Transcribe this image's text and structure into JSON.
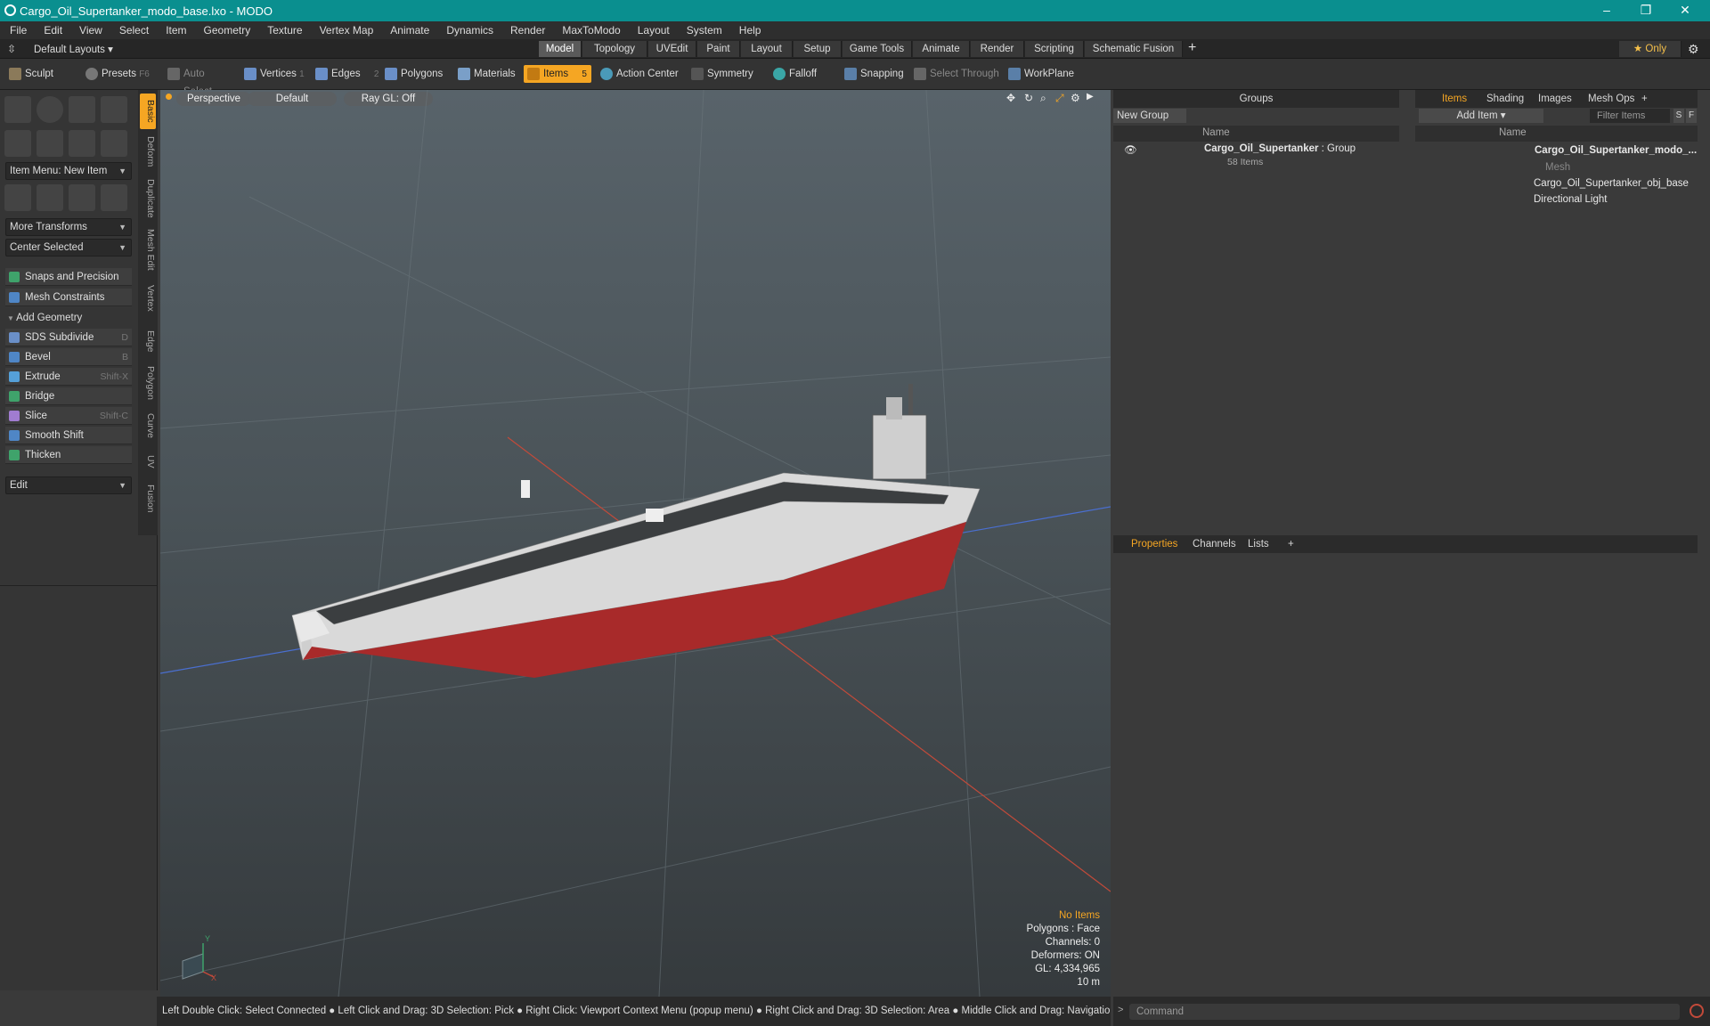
{
  "window": {
    "title": "Cargo_Oil_Supertanker_modo_base.lxo - MODO",
    "minimize": "–",
    "maximize": "❐",
    "close": "✕"
  },
  "menu": [
    "File",
    "Edit",
    "View",
    "Select",
    "Item",
    "Geometry",
    "Texture",
    "Vertex Map",
    "Animate",
    "Dynamics",
    "Render",
    "MaxToModo",
    "Layout",
    "System",
    "Help"
  ],
  "layoutbar": {
    "layouts_label": "Default Layouts ▾",
    "tabs": [
      "Model",
      "Topology",
      "UVEdit",
      "Paint",
      "Layout",
      "Setup",
      "Game Tools",
      "Animate",
      "Render",
      "Scripting",
      "Schematic Fusion"
    ],
    "active_tab": "Model",
    "add_tab": "+",
    "only_label": "★ Only"
  },
  "toolbar": {
    "sculpt": "Sculpt",
    "presets": "Presets",
    "presets_key": "F6",
    "auto_select": "Auto Select",
    "vertices": "Vertices",
    "vertices_count": "1",
    "edges": "Edges",
    "edges_count": "2",
    "polygons": "Polygons",
    "materials": "Materials",
    "items": "Items",
    "items_count": "5",
    "action_center": "Action Center",
    "symmetry": "Symmetry",
    "falloff": "Falloff",
    "snapping": "Snapping",
    "select_through": "Select Through",
    "workplane": "WorkPlane"
  },
  "left": {
    "vtabs": [
      "Basic",
      "Deform",
      "Duplicate",
      "Mesh Edit",
      "Vertex",
      "Edge",
      "Polygon",
      "Curve",
      "UV",
      "Fusion"
    ],
    "item_menu": "Item Menu: New Item",
    "more_transforms": "More Transforms",
    "center_selected": "Center Selected",
    "snaps": "Snaps and Precision",
    "mesh_constraints": "Mesh Constraints",
    "add_geometry": "Add Geometry",
    "tools": [
      {
        "label": "SDS Subdivide",
        "shortcut": "D",
        "color": "#6a8fc8"
      },
      {
        "label": "Bevel",
        "shortcut": "B",
        "color": "#4f86c6"
      },
      {
        "label": "Extrude",
        "shortcut": "Shift-X",
        "color": "#55a0d8"
      },
      {
        "label": "Bridge",
        "shortcut": "",
        "color": "#3fa36b"
      },
      {
        "label": "Slice",
        "shortcut": "Shift-C",
        "color": "#a07cd0"
      },
      {
        "label": "Smooth Shift",
        "shortcut": "",
        "color": "#4f86c6"
      },
      {
        "label": "Thicken",
        "shortcut": "",
        "color": "#3fa36b"
      }
    ],
    "edit": "Edit"
  },
  "viewport": {
    "perspective": "Perspective",
    "shading": "Default",
    "raygl": "Ray GL: Off",
    "stats": {
      "selection": "No Items",
      "polygons": "Polygons : Face",
      "channels": "Channels: 0",
      "deformers": "Deformers: ON",
      "gl": "GL: 4,334,965",
      "scale": "10 m"
    },
    "axis_y": "Y",
    "axis_x": "X"
  },
  "status": "Left Double Click: Select Connected ● Left Click and Drag: 3D Selection: Pick ● Right Click: Viewport Context Menu (popup menu) ● Right Click and Drag: 3D Selection: Area ● Middle Click and Drag: Navigation: Pan",
  "groups": {
    "title": "Groups",
    "new_group": "New Group",
    "name_header": "Name",
    "row_name": "Cargo_Oil_Supertanker",
    "row_type": ": Group",
    "row_count": "58 Items"
  },
  "items_panel": {
    "tabs": [
      "Items",
      "Shading",
      "Images",
      "Mesh Ops"
    ],
    "add_tab": "+",
    "add_item": "Add Item",
    "filter": "Filter Items",
    "s_btn": "S",
    "f_btn": "F",
    "name_header": "Name",
    "rows": [
      "Cargo_Oil_Supertanker_modo_...",
      "Mesh",
      "Cargo_Oil_Supertanker_obj_base",
      "Directional Light"
    ]
  },
  "props": {
    "tabs": [
      "Properties",
      "Channels",
      "Lists"
    ],
    "add_tab": "+"
  },
  "command": {
    "placeholder": "Command",
    "prompt": ">"
  }
}
